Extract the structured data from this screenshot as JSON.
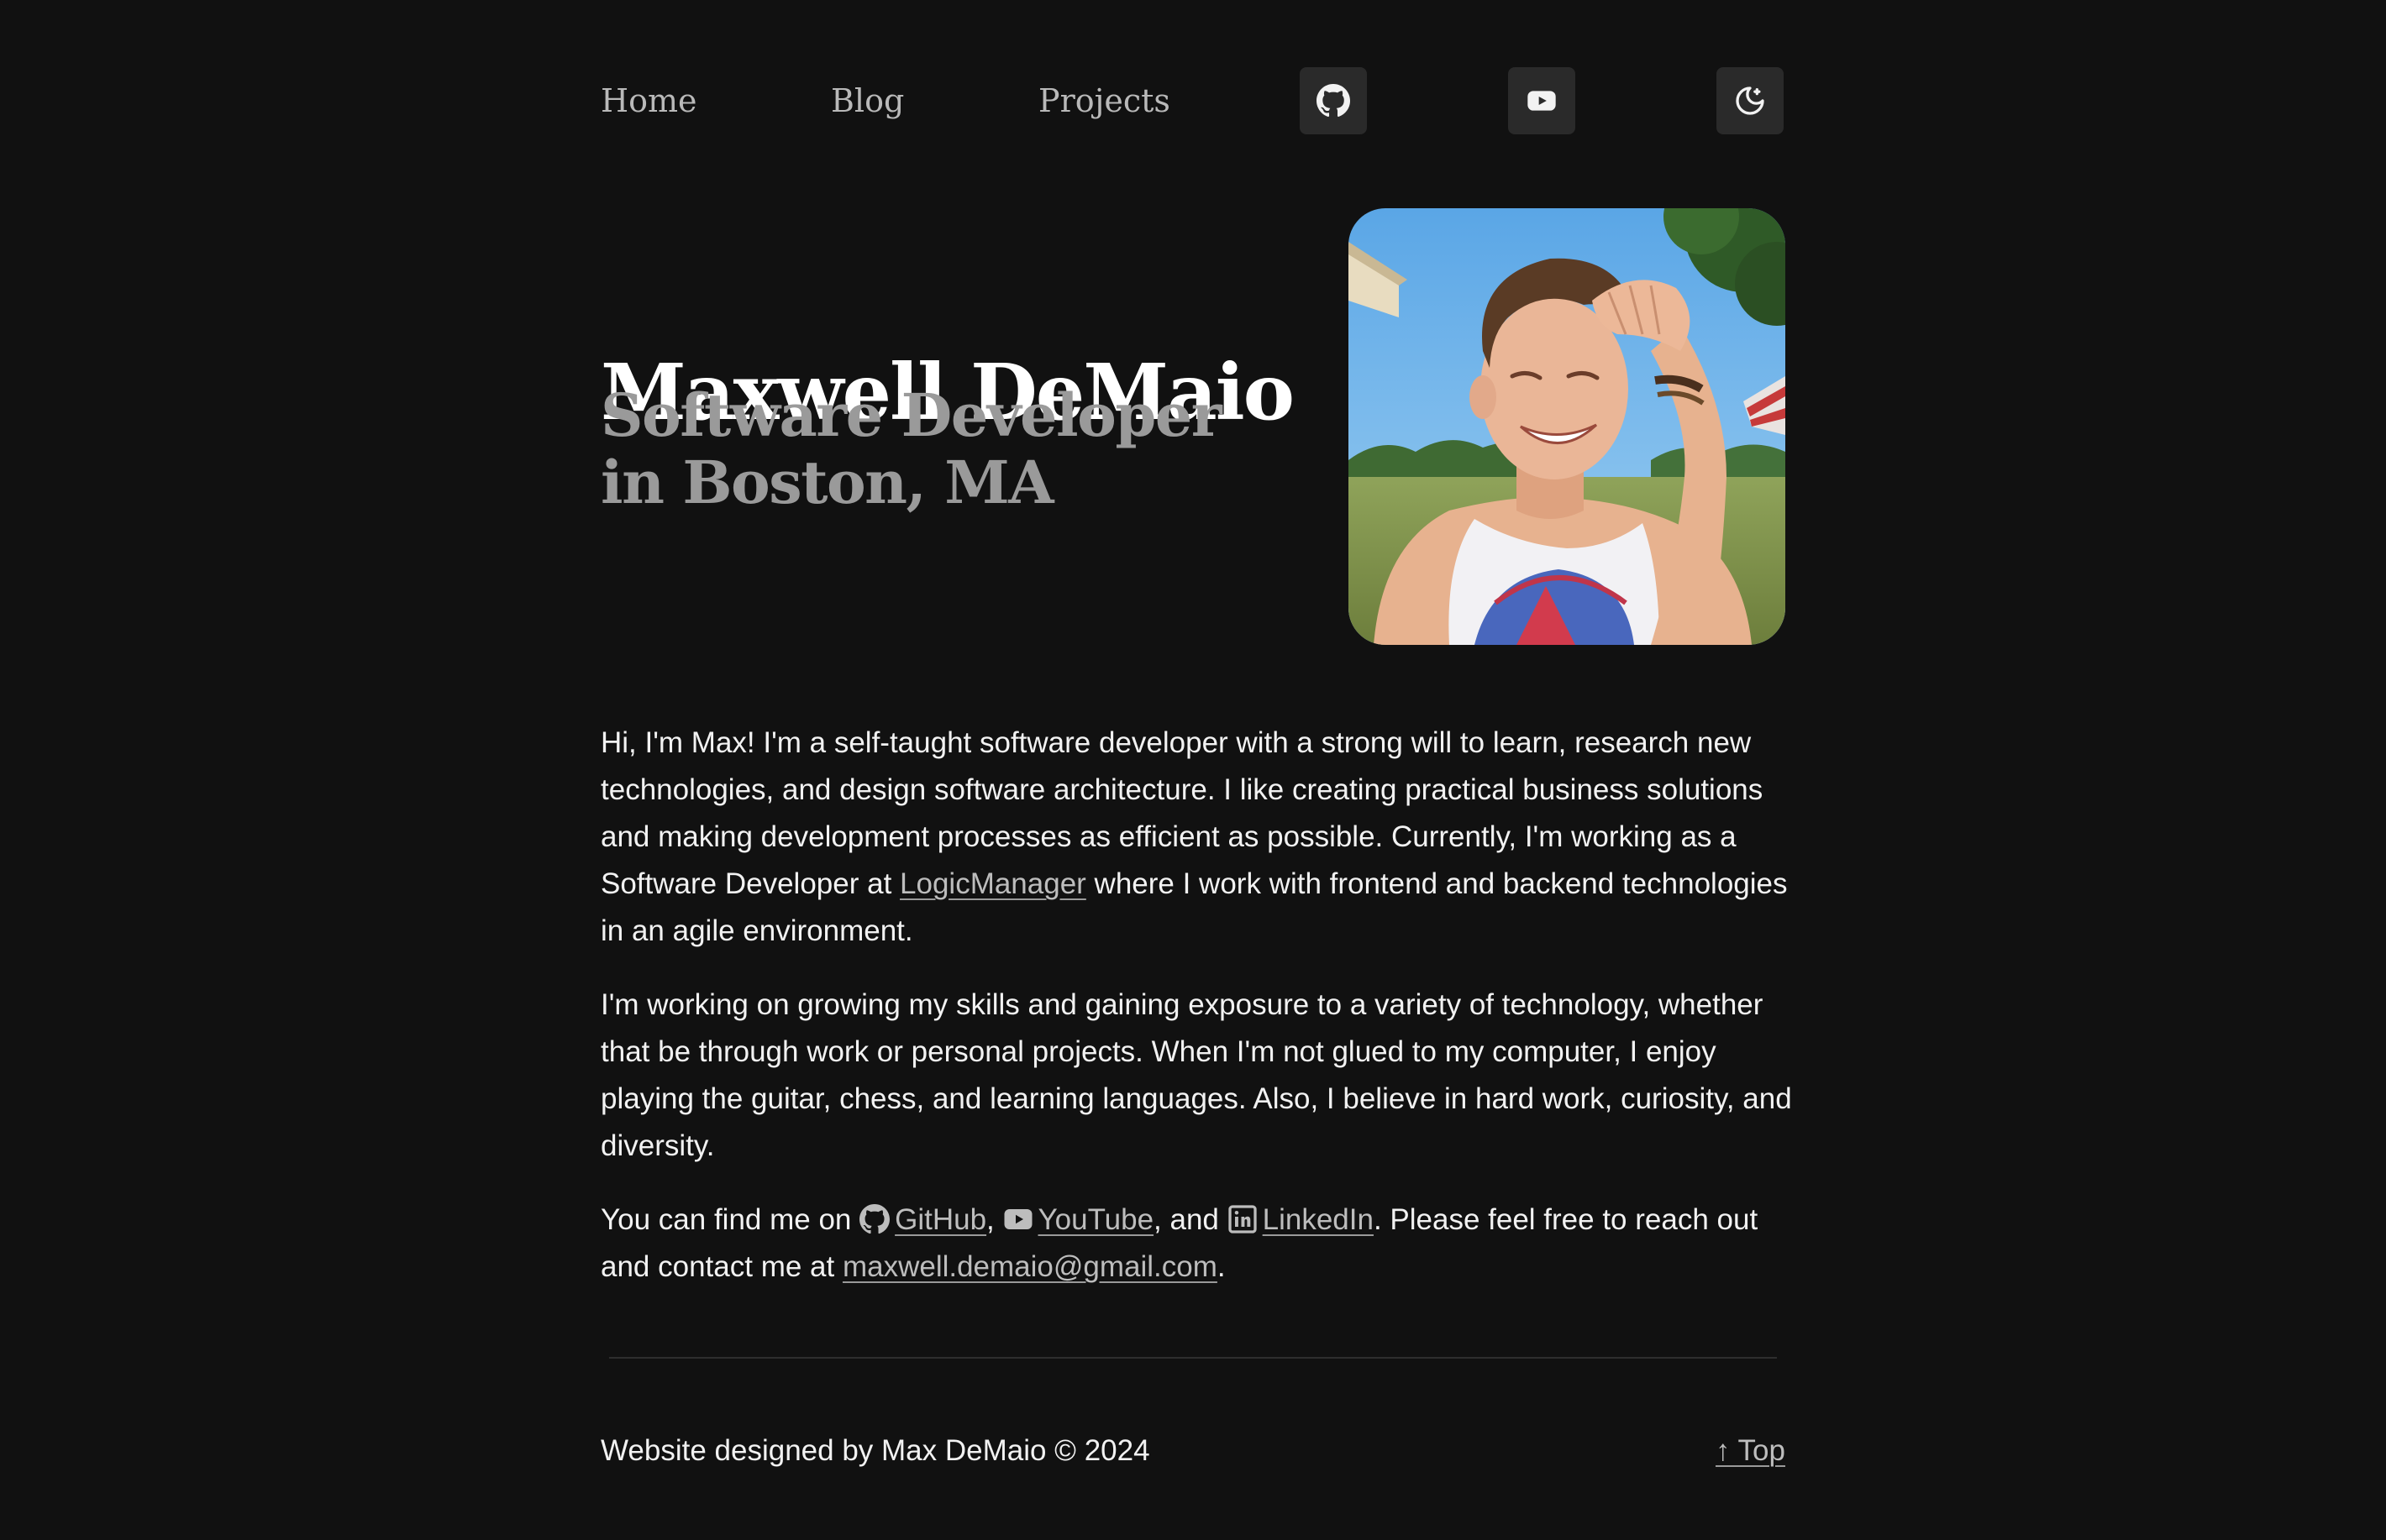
{
  "nav": {
    "links": [
      {
        "label": "Home"
      },
      {
        "label": "Blog"
      },
      {
        "label": "Projects"
      }
    ],
    "icons": [
      "github-icon",
      "youtube-icon",
      "moon-icon"
    ]
  },
  "hero": {
    "name": "Maxwell DeMaio",
    "subtitle": "Software Developer in Boston, MA",
    "photo_icon": "profile-photo"
  },
  "about": {
    "p1_before": "Hi, I'm Max! I'm a self-taught software developer with a strong will to learn, research new technologies, and design software architecture. I like creating practical business solutions and making development processes as efficient as possible. Currently, I'm working as a Software Developer at ",
    "p1_link": "LogicManager",
    "p1_after": " where I work with frontend and backend technologies in an agile environment.",
    "p2": "I'm working on growing my skills and gaining exposure to a variety of technology, whether that be through work or personal projects. When I'm not glued to my computer, I enjoy playing the guitar, chess, and learning languages. Also, I believe in hard work, curiosity, and diversity.",
    "p3_prefix": "You can find me on ",
    "github_label": "GitHub",
    "sep1": ", ",
    "youtube_label": "YouTube",
    "sep2": ", and ",
    "linkedin_label": "LinkedIn",
    "p3_mid": ". Please feel free to reach out and contact me at ",
    "email": "maxwell.demaio@gmail.com",
    "p3_end": "."
  },
  "footer": {
    "credit": "Website designed by Max DeMaio © 2024",
    "top_label": "↑ Top"
  },
  "colors": {
    "background": "#111111",
    "button_bg": "#2a2a2a",
    "text": "#f2f2f2",
    "muted": "#9a9a9a",
    "link": "#bdbdbd"
  }
}
